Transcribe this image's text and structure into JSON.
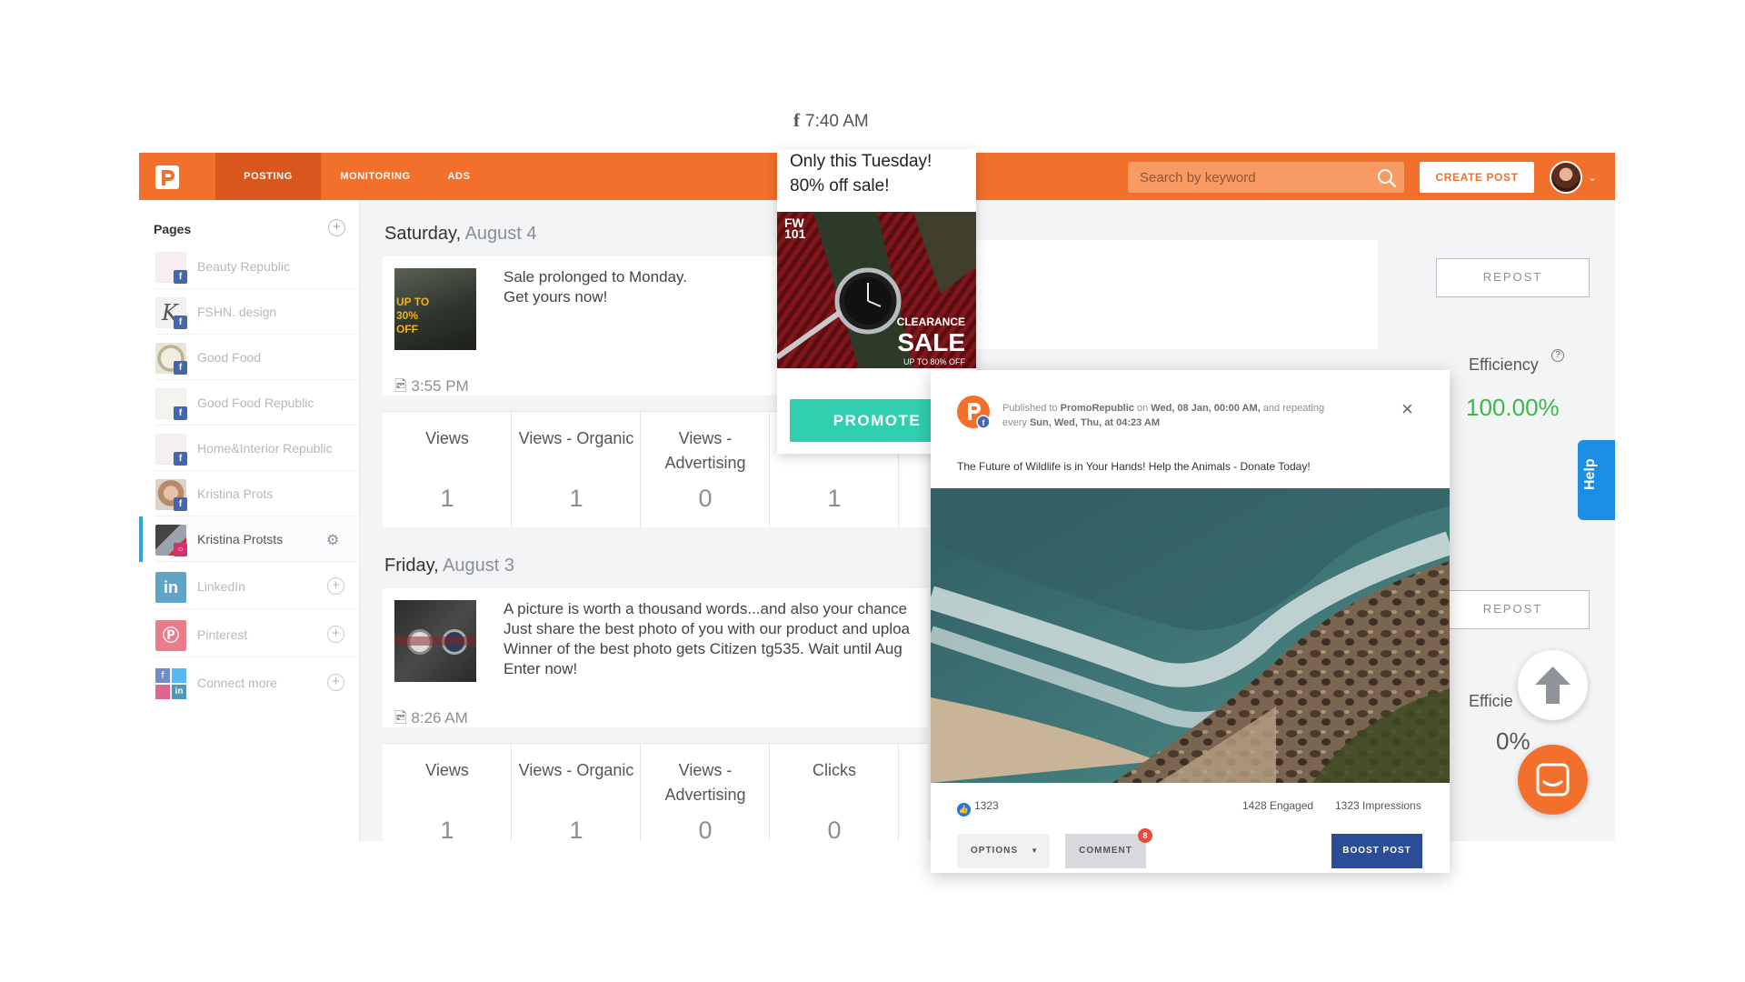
{
  "app": {
    "nav": [
      "POSTING",
      "MONITORING",
      "ADS"
    ],
    "search": {
      "placeholder": "Search by keyword"
    },
    "create_post_label": "CREATE POST"
  },
  "sidebar": {
    "title": "Pages",
    "items": [
      {
        "name": "Beauty Republic",
        "network": "facebook",
        "active": false
      },
      {
        "name": "FSHN. design",
        "network": "facebook",
        "active": false
      },
      {
        "name": "Good Food",
        "network": "facebook",
        "active": false
      },
      {
        "name": "Good Food Republic",
        "network": "facebook",
        "active": false
      },
      {
        "name": "Home&Interior Republic",
        "network": "facebook",
        "active": false
      },
      {
        "name": "Kristina Prots",
        "network": "facebook",
        "active": false
      },
      {
        "name": "Kristina Protsts",
        "network": "instagram",
        "active": true
      },
      {
        "name": "LinkedIn",
        "network": "linkedin",
        "active": false
      },
      {
        "name": "Pinterest",
        "network": "pinterest",
        "active": false
      },
      {
        "name": "Connect more",
        "network": "multi",
        "active": false
      }
    ]
  },
  "feed": {
    "days": [
      {
        "weekday": "Saturday,",
        "date": "August 4",
        "post_text": "Sale prolonged to Monday.\nGet yours now!",
        "time": "3:55 PM",
        "thumb_text": "UP TO\n30%\nOFF",
        "stats": [
          {
            "label": "Views",
            "value": "1"
          },
          {
            "label": "Views - Organic",
            "value": "1"
          },
          {
            "label": "Views -\nAdvertising",
            "value": "0"
          },
          {
            "label": "",
            "value": "1"
          }
        ]
      },
      {
        "weekday": "Friday,",
        "date": "August 3",
        "post_text": "A picture is worth a thousand words...and also your chance\nJust share the best photo of you with our product and uploa\nWinner of the best photo gets Citizen tg535. Wait until Aug\nEnter now!",
        "time": "8:26 AM",
        "stats": [
          {
            "label": "Views",
            "value": "1"
          },
          {
            "label": "Views - Organic",
            "value": "1"
          },
          {
            "label": "Views -\nAdvertising",
            "value": "0"
          },
          {
            "label": "Clicks",
            "value": "0"
          }
        ]
      }
    ],
    "repost_label": "REPOST",
    "efficiency_label": "Efficiency",
    "efficiency_label_cut": "Efficie",
    "efficiency_values": [
      "100.00%",
      "0%"
    ],
    "efficiency_colors": [
      "#3cb84a",
      "#555555"
    ],
    "help_label": "Help"
  },
  "promote": {
    "time": "7:40 AM",
    "text": "Only this Tuesday!\n80% off sale!",
    "image_text": {
      "brand": "FW\n101",
      "headline_1": "CLEARANCE",
      "headline_2": "SALE",
      "sub": "UP TO 80% OFF"
    },
    "button_label": "PROMOTE"
  },
  "preview": {
    "published_prefix": "Published to",
    "page": "PromoRepublic",
    "published_on": "on",
    "published_date": "Wed, 08 Jan, 00:00 AM,",
    "repeat_text": "and repeating every",
    "repeat_days": "Sun, Wed, Thu, at 04:23 AM",
    "caption": "The Future of Wildlife is in Your Hands! Help the Animals -  Donate Today!",
    "likes": "1323",
    "engaged": "1428 Engaged",
    "impressions": "1323 Impressions",
    "options_label": "OPTIONS",
    "comment_label": "COMMENT",
    "comment_count": "8",
    "boost_label": "BOOST POST"
  },
  "colors": {
    "brand": "#f26f2c",
    "promote": "#2fcfb0",
    "help": "#1c8ee6",
    "boost": "#2c4c95"
  }
}
